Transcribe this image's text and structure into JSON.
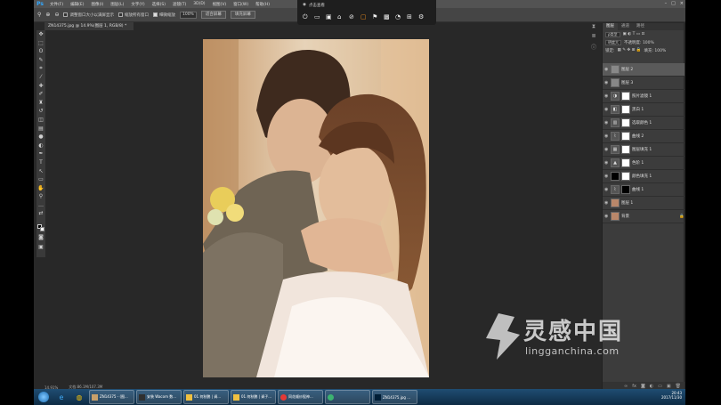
{
  "app": {
    "logo": "Ps"
  },
  "menu": [
    "文件(F)",
    "编辑(E)",
    "图像(I)",
    "图层(L)",
    "文字(Y)",
    "选择(S)",
    "滤镜(T)",
    "3D(D)",
    "视图(V)",
    "窗口(W)",
    "帮助(H)"
  ],
  "options": {
    "resize_windows": "调整窗口大小以满屏显示",
    "zoom_all": "缩放所有窗口",
    "scrubby_zoom": "细微缩放",
    "zoom_value": "100%",
    "fit_screen": "适合屏幕",
    "fill_screen": "填充屏幕"
  },
  "document_tab": "ZN14375.jpg @ 14.9%(图层 1, RGB/8) *",
  "overlay": {
    "title": "点击查看"
  },
  "statusbar": {
    "zoom": "14.91%",
    "doc": "文档:86.1M/107.3M"
  },
  "panel": {
    "tabs": [
      "图层",
      "通道",
      "路径"
    ],
    "kind": "ρ类型",
    "blend": "明度大",
    "opacity": "不透明度: 100%",
    "lock": "锁定:",
    "fill": "填充: 100%"
  },
  "layers": [
    {
      "name": "图层 2",
      "thumb": "gray",
      "selected": true
    },
    {
      "name": "图层 3",
      "thumb": "gray"
    },
    {
      "name": "照片滤镜 1",
      "thumb": "adj"
    },
    {
      "name": "黑白 1",
      "thumb": "adj"
    },
    {
      "name": "选取颜色 1",
      "thumb": "adj"
    },
    {
      "name": "曲线 2",
      "thumb": "adj"
    },
    {
      "name": "图层填充 1",
      "thumb": "adj"
    },
    {
      "name": "色阶 1",
      "thumb": "adj"
    },
    {
      "name": "颜色填充 1",
      "thumb": "black"
    },
    {
      "name": "曲线 1",
      "thumb": "adj"
    },
    {
      "name": "图层 1",
      "thumb": "photo"
    },
    {
      "name": "背景",
      "thumb": "photo"
    }
  ],
  "taskbar": {
    "buttons": [
      "ZN14375 - (图...",
      "安装 Wacom 数...",
      "01.何秋鹏 | 调...",
      "01.何秋鹏 | 调子...",
      "同花顺炒股神...",
      "",
      "ZN14375.jpg ..."
    ],
    "time": "20:43",
    "date": "2017/11/30"
  },
  "watermark": {
    "cn": "灵感中国",
    "en": "lingganchina.com"
  }
}
